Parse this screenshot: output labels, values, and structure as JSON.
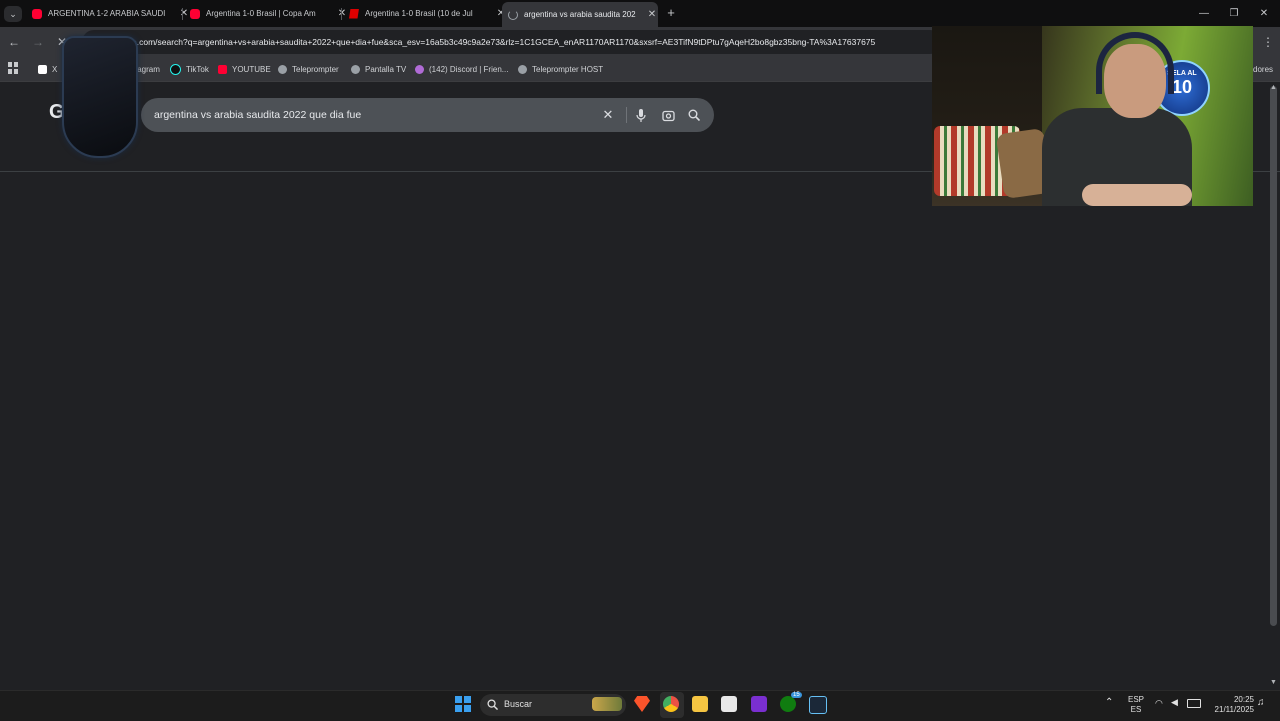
{
  "tabs": [
    {
      "label": "ARGENTINA 1-2 ARABIA SAUDI",
      "icon": "youtube-icon",
      "active": false
    },
    {
      "label": "Argentina 1-0 Brasil | Copa Am",
      "icon": "youtube-icon",
      "active": false
    },
    {
      "label": "Argentina 1-0 Brasil (10 de Jul",
      "icon": "espn-icon",
      "active": false
    },
    {
      "label": "argentina vs arabia saudita 202",
      "icon": "loading-icon",
      "active": true
    }
  ],
  "toolbar": {
    "url": "e.com/search?q=argentina+vs+arabia+saudita+2022+que+dia+fue&sca_esv=16a5b3c49c9a2e73&rlz=1C1GCEA_enAR1170AR1170&sxsrf=AE3TifN9tDPtu7gAqeH2bo8gbz35bng-TA%3A17637675"
  },
  "bookmarks": [
    {
      "label": "X",
      "icon": "x-icon"
    },
    {
      "label": "stagram",
      "icon": "instagram-icon"
    },
    {
      "label": "TikTok",
      "icon": "tiktok-icon"
    },
    {
      "label": "YOUTUBE",
      "icon": "youtube-icon"
    },
    {
      "label": "Teleprompter",
      "icon": "globe-icon"
    },
    {
      "label": "Pantalla TV",
      "icon": "globe-icon"
    },
    {
      "label": "(142) Discord | Frien...",
      "icon": "discord-icon"
    },
    {
      "label": "Teleprompter HOST",
      "icon": "globe-icon"
    }
  ],
  "bookmarks_overflow": "dores",
  "search": {
    "logo": "G",
    "query": "argentina vs arabia saudita 2022 que dia fue"
  },
  "webcam": {
    "sign_text": "SELA AL",
    "sign_number": "10"
  },
  "taskbar": {
    "search_label": "Buscar",
    "lang_top": "ESP",
    "lang_bottom": "ES",
    "time": "20:25",
    "date": "21/11/2025",
    "xbox_badge": "15"
  },
  "colors": {
    "page_bg": "#202124",
    "toolbar_bg": "#35363a",
    "searchbox_bg": "#4d5156",
    "youtube_red": "#ff0033"
  }
}
